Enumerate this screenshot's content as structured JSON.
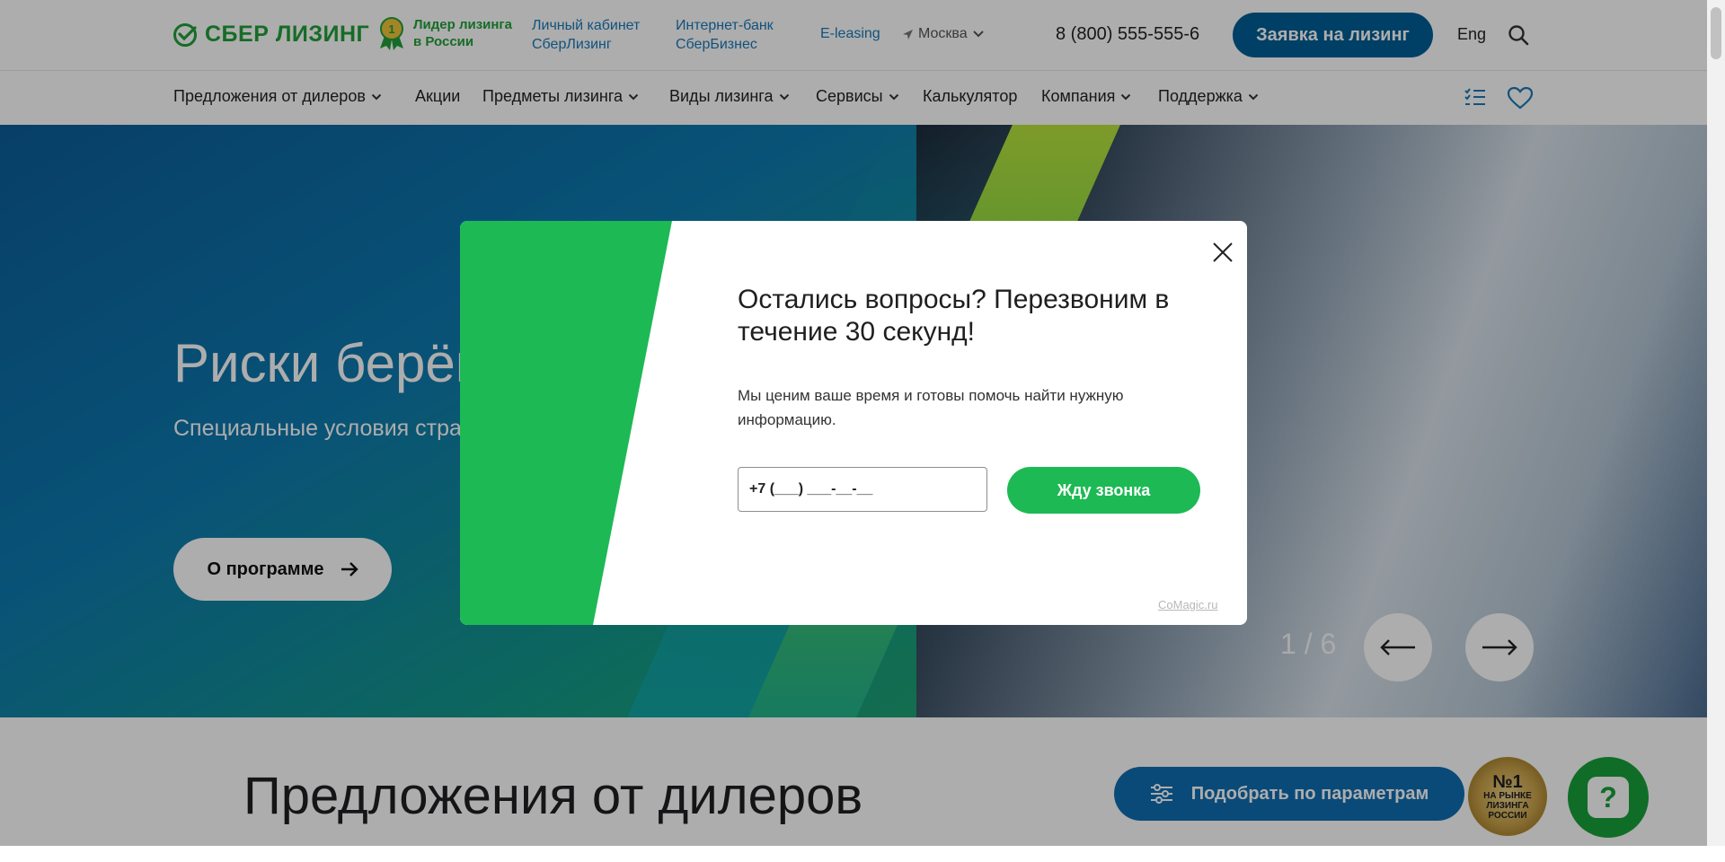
{
  "header": {
    "logo_text": "СБЕР ЛИЗИНГ",
    "leader_line1": "Лидер лизинга",
    "leader_line2": "в России",
    "cabinet_line1": "Личный кабинет",
    "cabinet_line2": "СберЛизинг",
    "bank_line1": "Интернет-банк",
    "bank_line2": "СберБизнес",
    "eleasing": "E-leasing",
    "city": "Москва",
    "phone": "8 (800) 555-555-6",
    "apply_label": "Заявка на лизинг",
    "lang": "Eng"
  },
  "nav": {
    "items": [
      "Предложения от дилеров",
      "Акции",
      "Предметы лизинга",
      "Виды лизинга",
      "Сервисы",
      "Калькулятор",
      "Компания",
      "Поддержка"
    ]
  },
  "hero": {
    "title": "Риски берём на себя",
    "subtitle": "Специальные условия страхования для спецтехники",
    "button_label": "О программе",
    "slide_counter": "1 / 6"
  },
  "dealers": {
    "title": "Предложения от дилеров",
    "filter_label": "Подобрать по параметрам"
  },
  "medal": {
    "big": "№1",
    "line1": "НА РЫНКЕ",
    "line2": "ЛИЗИНГА",
    "line3": "РОССИИ"
  },
  "help": {
    "label": "?"
  },
  "modal": {
    "title": "Остались вопросы? Перезвоним в течение 30 секунд!",
    "text": "Мы ценим ваше время и готовы помочь найти нужную информацию.",
    "phone_value": "+7 (___) ___-__-__",
    "button_label": "Жду звонка",
    "credit": "CoMagic.ru"
  },
  "colors": {
    "sber_green": "#21a038",
    "primary_blue": "#005f97",
    "modal_green": "#1db954"
  }
}
